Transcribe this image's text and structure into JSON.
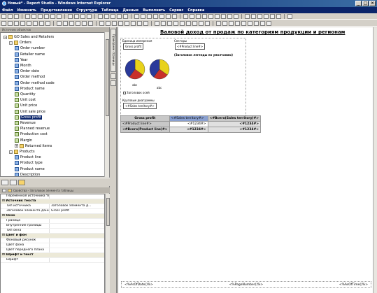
{
  "window": {
    "title": "Новый* - Report Studio - Windows Internet Explorer"
  },
  "menu": [
    "Файл",
    "Изменить",
    "Представление",
    "Структура",
    "Таблица",
    "Данные",
    "Выполнить",
    "Сервис",
    "Справка"
  ],
  "left_panel": {
    "header": "Источник объектов",
    "tree": [
      {
        "label": "GO Sales and Retailers",
        "kind": "folder",
        "level": 0,
        "expanded": true
      },
      {
        "label": "Orders",
        "kind": "folder",
        "level": 1,
        "expanded": true
      },
      {
        "label": "Order number",
        "kind": "dim",
        "level": 2
      },
      {
        "label": "Retailer name",
        "kind": "dim",
        "level": 2
      },
      {
        "label": "Year",
        "kind": "dim",
        "level": 2
      },
      {
        "label": "Month",
        "kind": "dim",
        "level": 2
      },
      {
        "label": "Order date",
        "kind": "dim",
        "level": 2
      },
      {
        "label": "Order method",
        "kind": "dim",
        "level": 2
      },
      {
        "label": "Order method code",
        "kind": "dim",
        "level": 2
      },
      {
        "label": "Product name",
        "kind": "dim",
        "level": 2
      },
      {
        "label": "Quantity",
        "kind": "calc",
        "level": 2
      },
      {
        "label": "Unit cost",
        "kind": "calc",
        "level": 2
      },
      {
        "label": "Unit price",
        "kind": "calc",
        "level": 2
      },
      {
        "label": "Unit sale price",
        "kind": "calc",
        "level": 2
      },
      {
        "label": "Gross profit",
        "kind": "calc",
        "level": 2,
        "selected": true
      },
      {
        "label": "Revenue",
        "kind": "calc",
        "level": 2
      },
      {
        "label": "Planned revenue",
        "kind": "calc",
        "level": 2
      },
      {
        "label": "Production cost",
        "kind": "calc",
        "level": 2
      },
      {
        "label": "Margin",
        "kind": "calc",
        "level": 2
      },
      {
        "label": "Returned items",
        "kind": "folder",
        "level": 2,
        "collapsed": true
      },
      {
        "label": "Products",
        "kind": "folder",
        "level": 1,
        "expanded": true
      },
      {
        "label": "Product line",
        "kind": "dim",
        "level": 2
      },
      {
        "label": "Product type",
        "kind": "dim",
        "level": 2
      },
      {
        "label": "Product name",
        "kind": "dim",
        "level": 2
      },
      {
        "label": "Description",
        "kind": "dim",
        "level": 2
      }
    ]
  },
  "properties": {
    "header": "Свойства - Заголовок элемента таблицы",
    "rows": [
      {
        "type": "row",
        "name": "Переменная источника текста",
        "value": ""
      },
      {
        "type": "cat",
        "name": "Источник текста"
      },
      {
        "type": "row",
        "name": "Тип источника",
        "value": "Заголовок элемента д..."
      },
      {
        "type": "row",
        "name": "Заголовок элемента данных",
        "value": "Gross profit"
      },
      {
        "type": "cat",
        "name": "Окно"
      },
      {
        "type": "row",
        "name": "Граница",
        "value": ""
      },
      {
        "type": "row",
        "name": "Внутренние границы",
        "value": ""
      },
      {
        "type": "row",
        "name": "Тип окна",
        "value": ""
      },
      {
        "type": "cat",
        "name": "Цвет и фон"
      },
      {
        "type": "row",
        "name": "Фоновый рисунок",
        "value": ""
      },
      {
        "type": "row",
        "name": "Цвет фона",
        "value": ""
      },
      {
        "type": "row",
        "name": "Цвет переднего плана",
        "value": ""
      },
      {
        "type": "cat",
        "name": "Шрифт и текст"
      },
      {
        "type": "row",
        "name": "Шрифт",
        "value": ""
      }
    ]
  },
  "side_tabs": [
    "Проводник страницы"
  ],
  "report": {
    "title": "Валовой доход от продаж по категориям продукции и регионам",
    "measure_label": "Единица измерения",
    "measure_value": "Gross profit",
    "sectors_label": "Секторы",
    "sectors_value": "<#Product line#>",
    "legend_label": "(Заголовок легенды по умолчанию)",
    "pie_labels": [
      "abc",
      "abc"
    ],
    "axis_title_label": "Заголовок осей",
    "pie_charts_label": "Круговые диаграммы",
    "pie_charts_value": "<#Sales territory#>",
    "crosstab": {
      "corner": "Gross profit",
      "col_header": "<#Sales territory#>",
      "col_total": "<#Всего(Sales territory)#>",
      "row_header": "<#Product line#>",
      "row_total": "<#Всего(Product line)#>",
      "cell": "<#1234#>"
    },
    "footer": {
      "left": "<%AsOfDate()%>",
      "center": "<%PageNumber()%>",
      "right": "<%AsOfTime()%>"
    }
  },
  "colors": {
    "pie_yellow": "#e8d21a",
    "pie_red": "#c8302a",
    "pie_blue": "#2a3a9a",
    "crosstab_header": "#c8c8c8",
    "crosstab_sel": "#8aa0d0"
  }
}
